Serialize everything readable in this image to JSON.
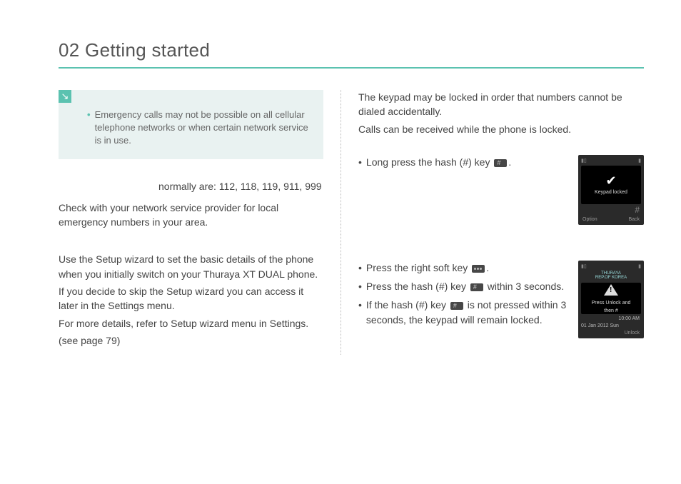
{
  "page": {
    "title": "02 Getting started"
  },
  "leftColumn": {
    "note": "Emergency calls may not be possible on all cellular telephone networks or when certain network service is in use.",
    "emergencyNumbersText": "normally are: 112, 118, 119, 911, 999",
    "emergencyFollowup": "Check with your network service provider for local emergency numbers in your area.",
    "setup1": "Use the Setup wizard to set the basic details of the phone when you initially switch on your Thuraya XT DUAL phone.",
    "setup2": "If you decide to skip the Setup wizard you can access it later in the Settings menu.",
    "setup3": "For more details, refer to Setup wizard menu in Settings.",
    "setup4": "(see page 79)"
  },
  "rightColumn": {
    "intro1": "The keypad may be locked in order that numbers cannot be dialed accidentally.",
    "intro2": "Calls can be received while the phone is locked.",
    "lockBullet": "Long press the hash (#) key ",
    "unlock1_a": "Press the right soft key ",
    "unlock2_a": "Press the hash (#) key ",
    "unlock2_b": " within 3 seconds.",
    "unlock3_a": "If the hash (#) key ",
    "unlock3_b": " is not pressed within 3 seconds, the keypad will remain locked."
  },
  "phone1": {
    "screenText": "Keypad locked",
    "softLeft": "Option",
    "softRight": "Back"
  },
  "phone2": {
    "carrier1": "THURAYA",
    "carrier2": "REP.OF KOREA",
    "msg1": "Press Unlock and",
    "msg2": "then #",
    "time": "10:00 AM",
    "date": "01 Jan 2012 Sun",
    "softRight": "Unlock"
  }
}
